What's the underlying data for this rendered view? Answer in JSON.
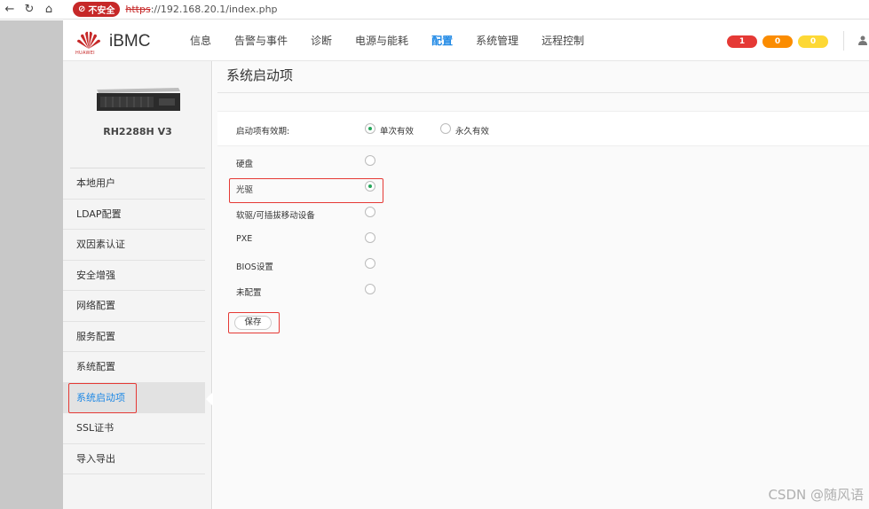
{
  "browser": {
    "security_label": "不安全",
    "url_scheme": "https",
    "url_rest": "://192.168.20.1/index.php"
  },
  "brand": {
    "name": "iBMC",
    "vendor": "HUAWEI",
    "color": "#c62828"
  },
  "nav": {
    "items": [
      {
        "label": "信息",
        "active": false
      },
      {
        "label": "告警与事件",
        "active": false
      },
      {
        "label": "诊断",
        "active": false
      },
      {
        "label": "电源与能耗",
        "active": false
      },
      {
        "label": "配置",
        "active": true
      },
      {
        "label": "系统管理",
        "active": false
      },
      {
        "label": "远程控制",
        "active": false
      }
    ],
    "alarms": [
      {
        "count": "1",
        "color": "#e53935"
      },
      {
        "count": "0",
        "color": "#fb8c00"
      },
      {
        "count": "0",
        "color": "#fdd835"
      }
    ]
  },
  "sidebar": {
    "model": "RH2288H V3",
    "items": [
      {
        "label": "本地用户"
      },
      {
        "label": "LDAP配置"
      },
      {
        "label": "双因素认证"
      },
      {
        "label": "安全增强"
      },
      {
        "label": "网络配置"
      },
      {
        "label": "服务配置"
      },
      {
        "label": "系统配置"
      },
      {
        "label": "系统启动项"
      },
      {
        "label": "SSL证书"
      },
      {
        "label": "导入导出"
      }
    ]
  },
  "main": {
    "title": "系统启动项",
    "validity_label": "启动项有效期:",
    "validity_options": [
      "单次有效",
      "永久有效"
    ],
    "validity_selected": "单次有效",
    "boot_options": [
      "硬盘",
      "光驱",
      "软驱/可插拔移动设备",
      "PXE",
      "BIOS设置",
      "未配置"
    ],
    "boot_selected": "光驱",
    "save_label": "保存"
  },
  "watermark": "CSDN @随风语",
  "colors": {
    "accent": "#1e88e5",
    "radio_checked": "#26a65b",
    "highlight": "#e53935"
  }
}
